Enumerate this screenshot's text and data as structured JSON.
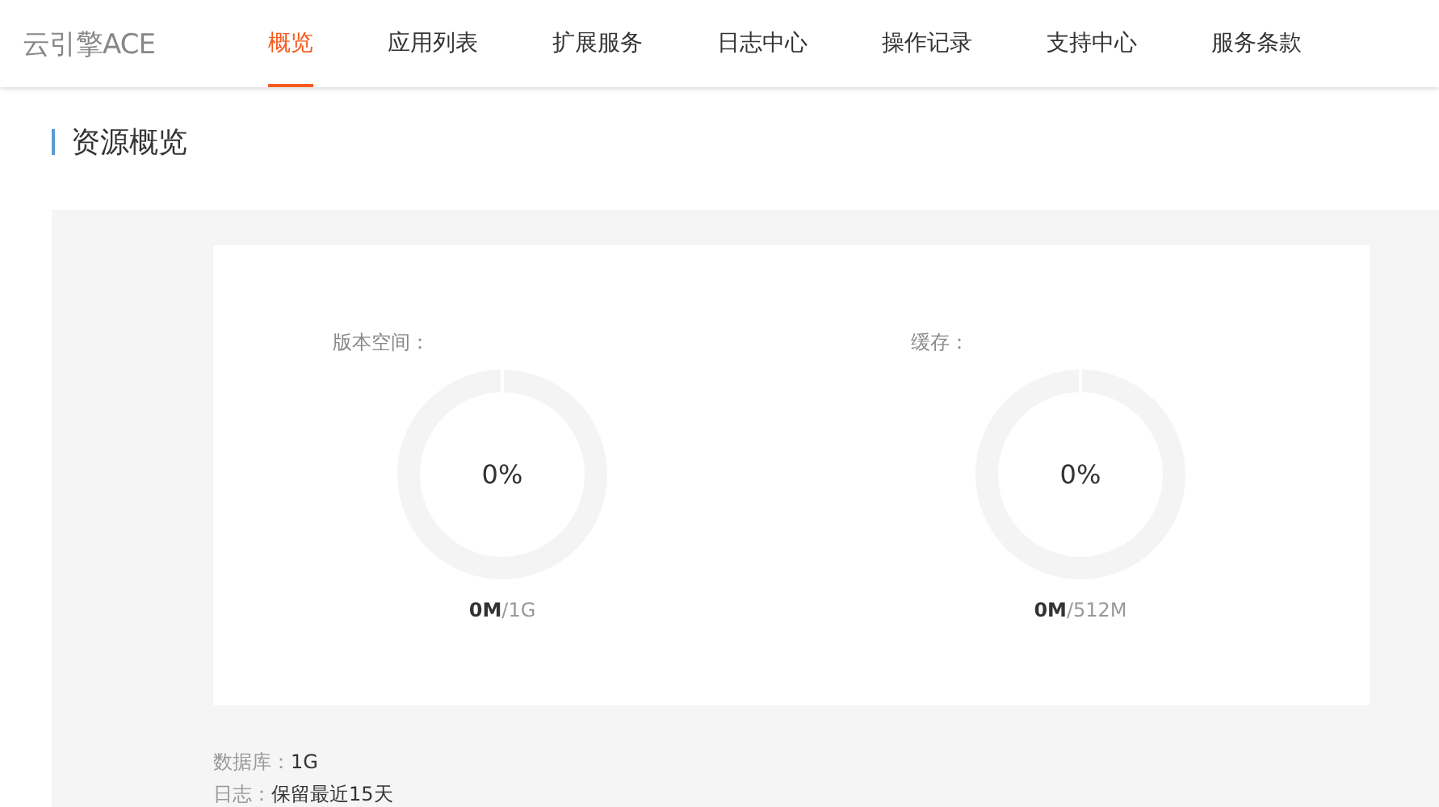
{
  "logo": "云引擎ACE",
  "nav": [
    {
      "label": "概览",
      "selected": true
    },
    {
      "label": "应用列表",
      "selected": false
    },
    {
      "label": "扩展服务",
      "selected": false
    },
    {
      "label": "日志中心",
      "selected": false
    },
    {
      "label": "操作记录",
      "selected": false
    },
    {
      "label": "支持中心",
      "selected": false
    },
    {
      "label": "服务条款",
      "selected": false
    }
  ],
  "section_title": "资源概览",
  "gauges": [
    {
      "label": "版本空间：",
      "percent": "0%",
      "level": 0,
      "used": "0M",
      "total": "/1G"
    },
    {
      "label": "缓存：",
      "percent": "0%",
      "level": 0,
      "used": "0M",
      "total": "/512M"
    }
  ],
  "details": [
    {
      "label": "数据库：",
      "value": "1G"
    },
    {
      "label": "日志：",
      "value": "保留最近15天"
    }
  ]
}
